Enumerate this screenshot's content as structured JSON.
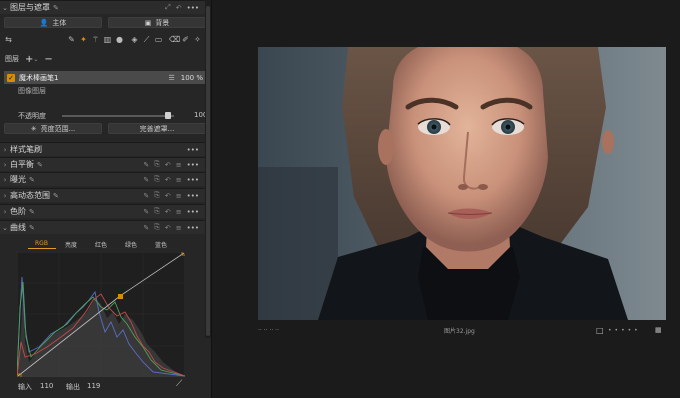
{
  "panel": {
    "layers_section_title": "图层与遮罩",
    "paint_button": "主体",
    "background_button": "背景",
    "layers_label": "图层",
    "layer_name": "魔术棒画笔1",
    "layer_opacity": "100 %",
    "layer_sub": "图像图层",
    "opacity_label": "不透明度",
    "opacity_value": "100",
    "brightness_range_button": "亮度范围...",
    "refine_mask_button": "完善遮罩...",
    "sections": [
      {
        "title": "样式笔刷"
      },
      {
        "title": "白平衡"
      },
      {
        "title": "曝光"
      },
      {
        "title": "高动态范围"
      },
      {
        "title": "色阶"
      },
      {
        "title": "曲线"
      }
    ],
    "curve_tabs": [
      "RGB",
      "亮度",
      "红色",
      "绿色",
      "蓝色"
    ],
    "input_label": "输入",
    "input_value": "110",
    "output_label": "输出",
    "output_value": "119",
    "curve_point": {
      "input": 110,
      "output": 119
    }
  },
  "viewer": {
    "filename": "图片32.jpg",
    "left_dots": "··  ··  ··  ··"
  },
  "colors": {
    "accent": "#e08a00",
    "panel": "#262626",
    "highlight": "#4a4a4a"
  }
}
